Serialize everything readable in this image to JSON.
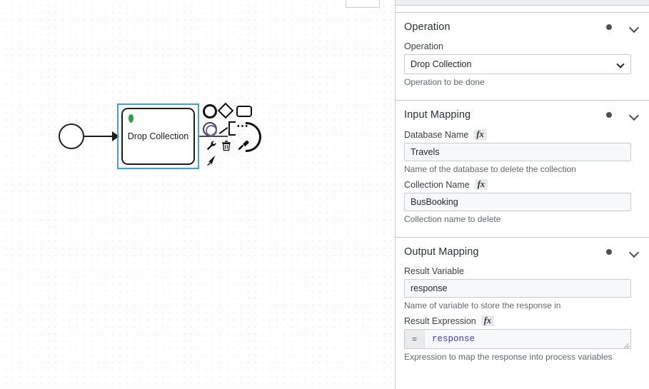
{
  "canvas": {
    "start_event": "start-event",
    "task": {
      "label": "Drop Collection",
      "marker": "leaf-marker"
    },
    "context_pad": [
      "circle-icon",
      "diamond-icon",
      "rounded-rect-icon",
      "double-circle-icon",
      "bracket-icon",
      "ellipsis-icon",
      "arc-icon",
      "wrench-icon",
      "trash-icon",
      "brush-icon",
      "pointer-icon"
    ]
  },
  "panel": {
    "groups": [
      {
        "title": "Operation",
        "fields": [
          {
            "label": "Operation",
            "type": "select",
            "value": "Drop Collection",
            "hint": "Operation to be done",
            "fx": false
          }
        ]
      },
      {
        "title": "Input Mapping",
        "fields": [
          {
            "label": "Database Name",
            "type": "text",
            "value": "Travels",
            "hint": "Name of the database to delete the collection",
            "fx": true,
            "fx_label": "fx"
          },
          {
            "label": "Collection Name",
            "type": "text",
            "value": "BusBooking",
            "hint": "Collection name to delete",
            "fx": true,
            "fx_label": "fx"
          }
        ]
      },
      {
        "title": "Output Mapping",
        "fields": [
          {
            "label": "Result Variable",
            "type": "text",
            "value": "response",
            "hint": "Name of variable to store the response in",
            "fx": false
          },
          {
            "label": "Result Expression",
            "type": "expression",
            "prefix": "=",
            "value": "response",
            "hint": "Expression to map the response into process variables",
            "fx": true,
            "fx_label": "fx"
          }
        ]
      }
    ]
  },
  "colors": {
    "selection": "#3aa1e6",
    "marker_green": "#2f9e44",
    "expression_text": "#3b3bd0",
    "panel_border": "#c9ccce"
  }
}
